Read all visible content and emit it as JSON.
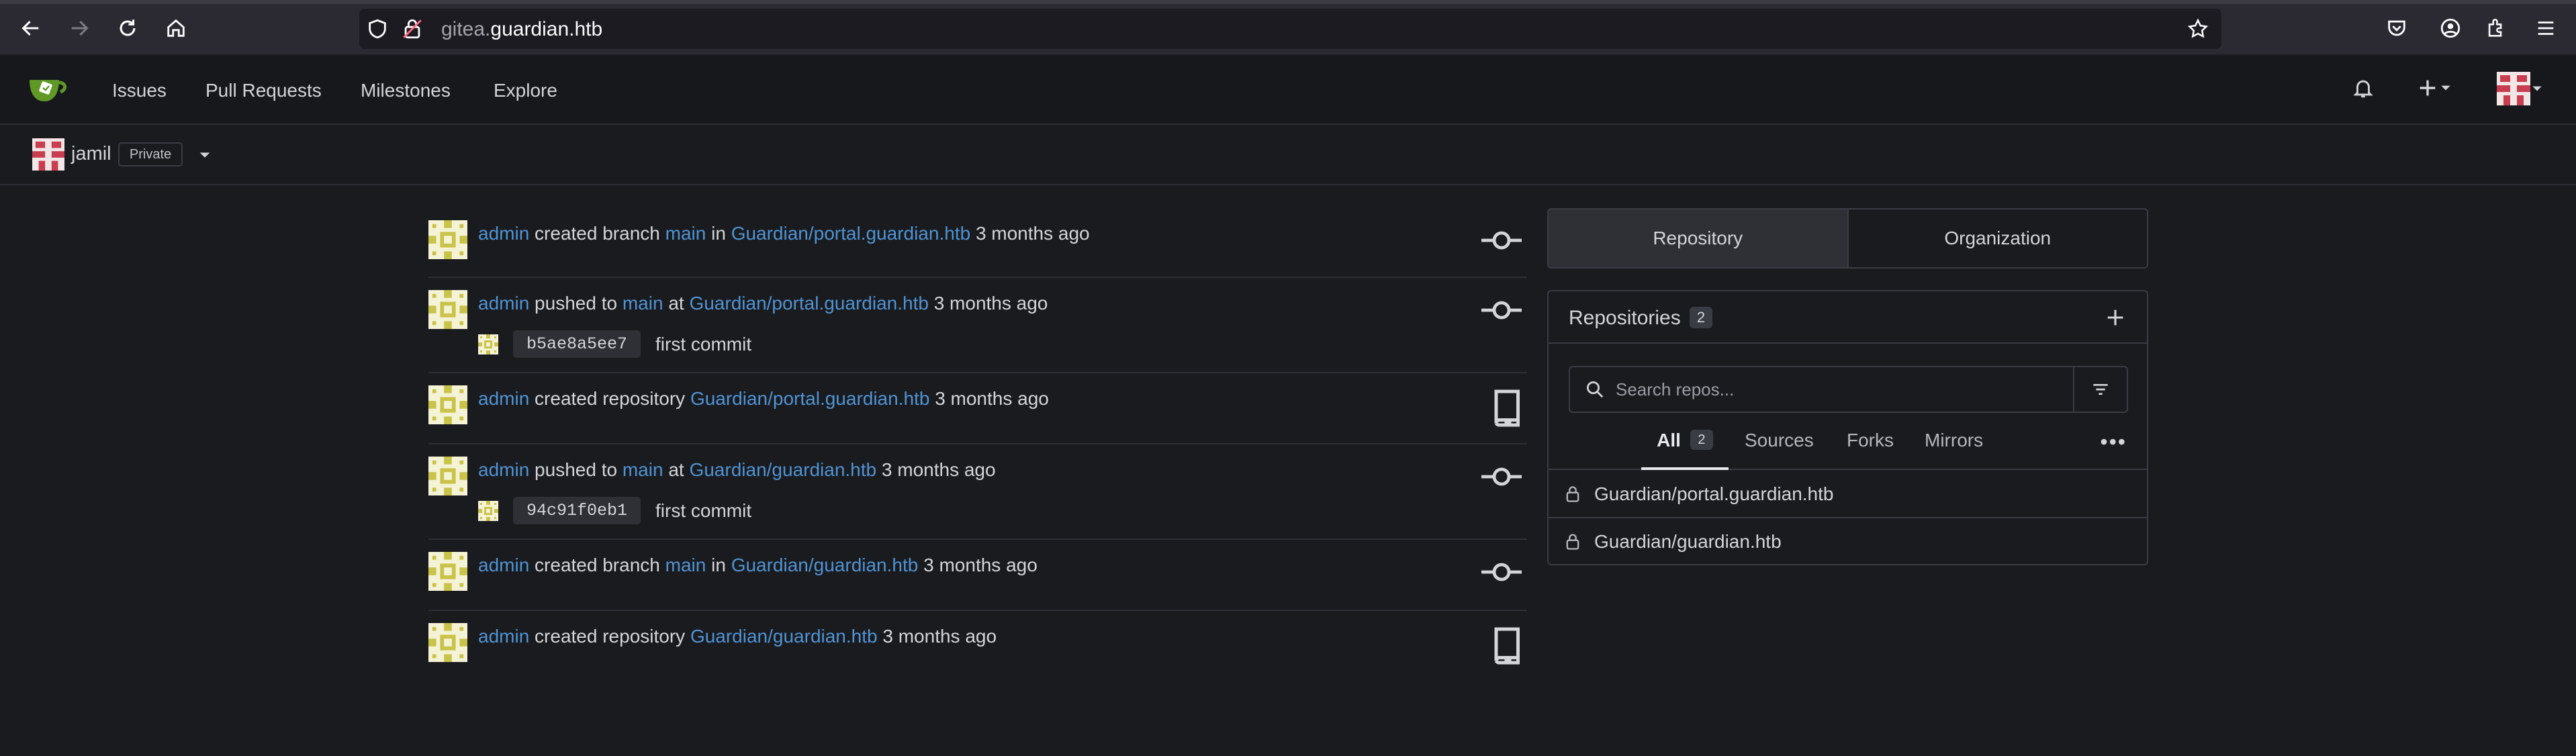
{
  "browser": {
    "url_sub": "gitea.",
    "url_domain": "guardian.htb"
  },
  "header": {
    "nav": [
      "Issues",
      "Pull Requests",
      "Milestones",
      "Explore"
    ]
  },
  "context": {
    "user": "jamil",
    "visibility": "Private"
  },
  "feed": [
    {
      "actor": "admin",
      "verb": "created branch",
      "ref": "main",
      "prep": "in",
      "repo": "Guardian/portal.guardian.htb",
      "time": "3 months ago",
      "icon": "commit-icon"
    },
    {
      "actor": "admin",
      "verb": "pushed to",
      "ref": "main",
      "prep": "at",
      "repo": "Guardian/portal.guardian.htb",
      "time": "3 months ago",
      "icon": "commit-icon",
      "sha": "b5ae8a5ee7",
      "message": "first commit"
    },
    {
      "actor": "admin",
      "verb": "created repository",
      "ref": "",
      "prep": "",
      "repo": "Guardian/portal.guardian.htb",
      "time": "3 months ago",
      "icon": "repo-icon"
    },
    {
      "actor": "admin",
      "verb": "pushed to",
      "ref": "main",
      "prep": "at",
      "repo": "Guardian/guardian.htb",
      "time": "3 months ago",
      "icon": "commit-icon",
      "sha": "94c91f0eb1",
      "message": "first commit"
    },
    {
      "actor": "admin",
      "verb": "created branch",
      "ref": "main",
      "prep": "in",
      "repo": "Guardian/guardian.htb",
      "time": "3 months ago",
      "icon": "commit-icon"
    },
    {
      "actor": "admin",
      "verb": "created repository",
      "ref": "",
      "prep": "",
      "repo": "Guardian/guardian.htb",
      "time": "3 months ago",
      "icon": "repo-icon"
    }
  ],
  "panel": {
    "tabs": [
      "Repository",
      "Organization"
    ],
    "title": "Repositories",
    "count": "2",
    "search_placeholder": "Search repos...",
    "filters": [
      {
        "label": "All",
        "count": "2"
      },
      {
        "label": "Sources"
      },
      {
        "label": "Forks"
      },
      {
        "label": "Mirrors"
      }
    ],
    "more": "•••",
    "repos": [
      "Guardian/portal.guardian.htb",
      "Guardian/guardian.htb"
    ]
  },
  "colors": {
    "link": "#4f94d4",
    "background": "#1a1b1f",
    "header": "#17181c"
  }
}
